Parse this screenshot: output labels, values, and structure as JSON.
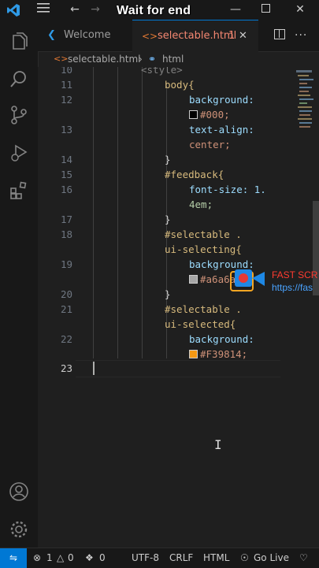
{
  "overlay": {
    "caption": "Wait for end"
  },
  "tabs": [
    {
      "label": "Welcome",
      "active": false
    },
    {
      "label": "selectable.html",
      "badge": "1",
      "active": true
    }
  ],
  "breadcrumb": {
    "file": "selectable.html",
    "node": "html"
  },
  "editor": {
    "lines": [
      {
        "n": "10",
        "text": "<style>"
      },
      {
        "n": "11",
        "text": "body{"
      },
      {
        "n": "12",
        "text": "background:"
      },
      {
        "n": "",
        "text": "#000;"
      },
      {
        "n": "13",
        "text": "text-align:"
      },
      {
        "n": "",
        "text": "center;"
      },
      {
        "n": "14",
        "text": "}"
      },
      {
        "n": "15",
        "text": "#feedback{"
      },
      {
        "n": "16",
        "text": "font-size: 1."
      },
      {
        "n": "",
        "text": "4em;"
      },
      {
        "n": "17",
        "text": "}"
      },
      {
        "n": "18",
        "text": "#selectable ."
      },
      {
        "n": "",
        "text": "ui-selecting{"
      },
      {
        "n": "19",
        "text": "background:"
      },
      {
        "n": "",
        "text": "#a6a6a6;"
      },
      {
        "n": "20",
        "text": "}"
      },
      {
        "n": "21",
        "text": "#selectable ."
      },
      {
        "n": "",
        "text": "ui-selected{"
      },
      {
        "n": "22",
        "text": "background:"
      },
      {
        "n": "",
        "text": "#F39814;"
      },
      {
        "n": "23",
        "text": ""
      }
    ],
    "colors": {
      "black_swatch": "#000000",
      "grey_swatch": "#a6a6a6",
      "orange_swatch": "#F39814"
    }
  },
  "watermark": {
    "line1": "FAST SCR",
    "line2": "https://fas"
  },
  "statusbar": {
    "errors": "1",
    "warnings": "0",
    "ports": "0",
    "encoding": "UTF-8",
    "eol": "CRLF",
    "language": "HTML",
    "live": "Go Live"
  }
}
